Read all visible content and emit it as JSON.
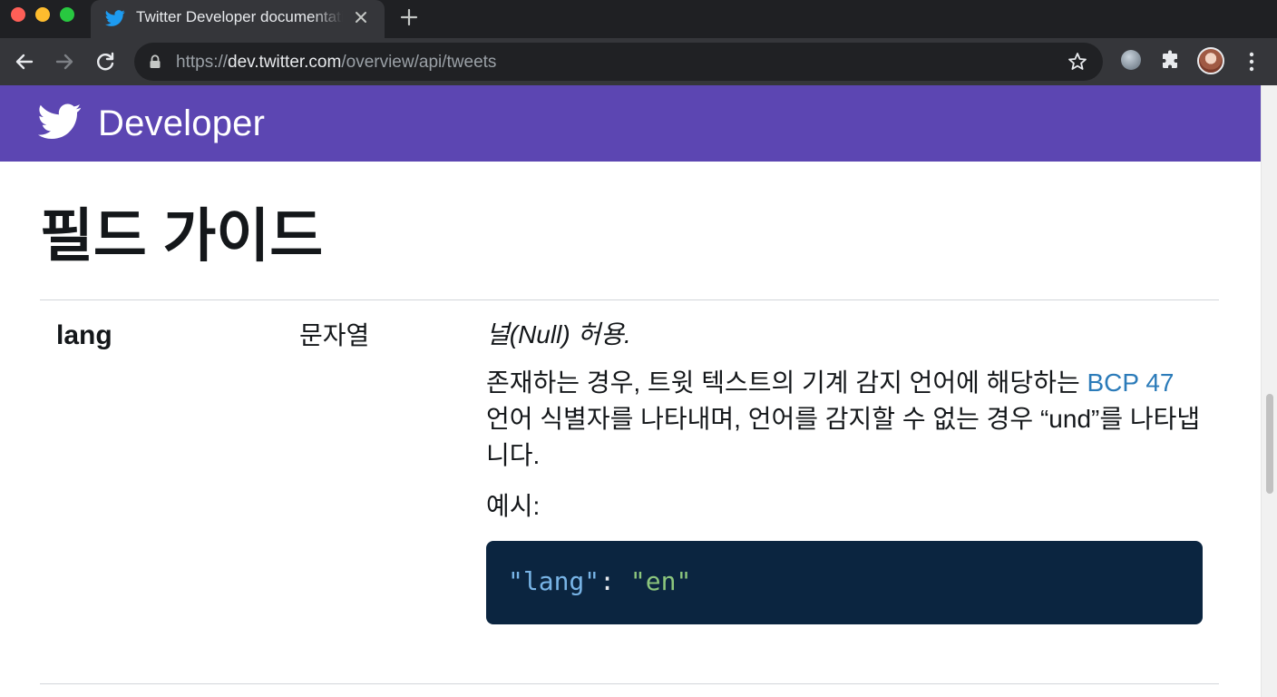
{
  "browser": {
    "tab_title": "Twitter Developer documentation",
    "url_scheme": "https://",
    "url_host": "dev.twitter.com",
    "url_path": "/overview/api/tweets"
  },
  "header": {
    "brand": "Developer",
    "color": "#5c46b2"
  },
  "page": {
    "title": "필드 가이드"
  },
  "field": {
    "name": "lang",
    "type": "문자열",
    "nullable": "널(Null) 허용.",
    "description_before_link": "존재하는 경우, 트윗 텍스트의 기계 감지 언어에 해당하는 ",
    "link_text": "BCP 47",
    "description_after_link": " 언어 식별자를 나타내며, 언어를 감지할 수 없는 경우 “und”를 나타냅니다.",
    "example_label": "예시:",
    "code": {
      "key": "\"lang\"",
      "separator": ": ",
      "value": "\"en\""
    }
  },
  "icons": {
    "tab_favicon": "twitter-bird-icon",
    "lock": "lock-icon",
    "star": "star-icon",
    "extensions": "puzzle-icon",
    "menu": "more-vert-icon"
  }
}
